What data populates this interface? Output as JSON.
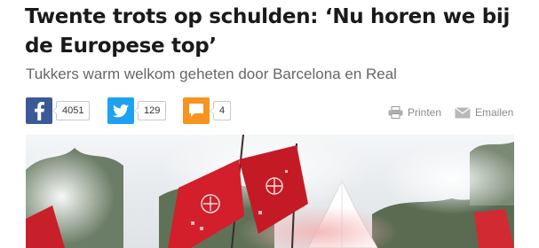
{
  "article": {
    "headline_line1": "Twente trots op schulden: ‘Nu horen we bij",
    "headline_line2": "de Europese top’",
    "subtitle": "Tukkers warm welkom geheten door Barcelona en Real"
  },
  "share": {
    "facebook": {
      "icon": "facebook-icon",
      "count": "4051",
      "color": "#3b5998"
    },
    "twitter": {
      "icon": "twitter-icon",
      "count": "129",
      "color": "#1da1f2"
    },
    "comments": {
      "icon": "comment-icon",
      "count": "4",
      "color": "#f7931e"
    }
  },
  "tools": {
    "print_label": "Printen",
    "print_icon": "printer-icon",
    "email_label": "Emailen",
    "email_icon": "envelope-icon"
  },
  "photo": {
    "subject": "fans-with-red-flags-and-smoke"
  }
}
